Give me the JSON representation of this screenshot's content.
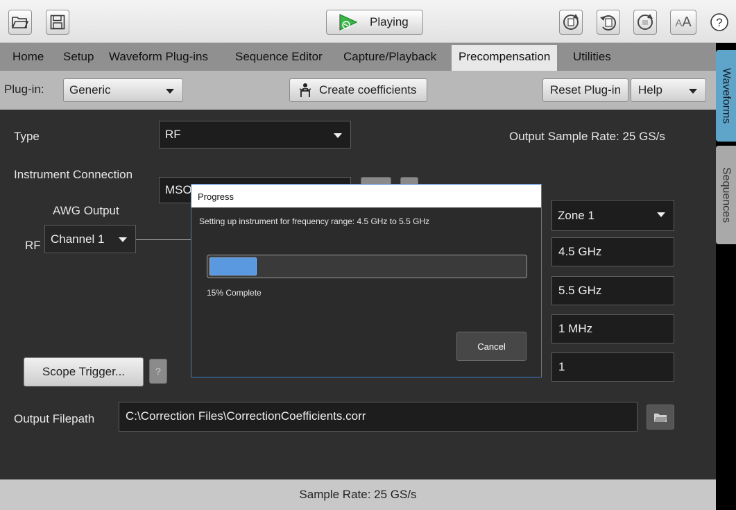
{
  "toolbar": {
    "play_label": "Playing",
    "font_size_label_small": "A",
    "font_size_label_large": "A",
    "help_label": "?"
  },
  "menu": {
    "items": [
      "Home",
      "Setup",
      "Waveform Plug-ins",
      "Sequence Editor",
      "Capture/Playback",
      "Precompensation",
      "Utilities"
    ],
    "active": "Precompensation"
  },
  "plugin_bar": {
    "plugin_label": "Plug-in:",
    "plugin_value": "Generic",
    "create_label": "Create coefficients",
    "reset_label": "Reset Plug-in",
    "help_value": "Help"
  },
  "form": {
    "type_label": "Type",
    "type_value": "RF",
    "output_sample_rate": "Output Sample Rate:  25 GS/s",
    "instrument_connection_label": "Instrument Connection",
    "instrument_value": "MSO",
    "awg_output_label": "AWG Output",
    "rf_label": "RF",
    "channel_value": "Channel 1",
    "zone_value": "Zone 1",
    "start_freq": "4.5 GHz",
    "stop_freq": "5.5 GHz",
    "step_freq": "1 MHz",
    "averages": "1",
    "scope_trigger_label": "Scope Trigger...",
    "question_mark": "?",
    "output_filepath_label": "Output Filepath",
    "output_filepath_value": "C:\\Correction Files\\CorrectionCoefficients.corr"
  },
  "dialog": {
    "title": "Progress",
    "message": "Setting up instrument for frequency range: 4.5 GHz to 5.5 GHz",
    "progress_fraction": 0.15,
    "progress_text": "15% Complete",
    "cancel_label": "Cancel"
  },
  "side_tabs": {
    "waveforms": "Waveforms",
    "sequences": "Sequences"
  },
  "status_bar": {
    "text": "Sample Rate: 25 GS/s"
  },
  "colors": {
    "accent_blue": "#5a98e0",
    "waveforms_tab": "#5fa5c9",
    "play_green": "#3bb54a"
  }
}
